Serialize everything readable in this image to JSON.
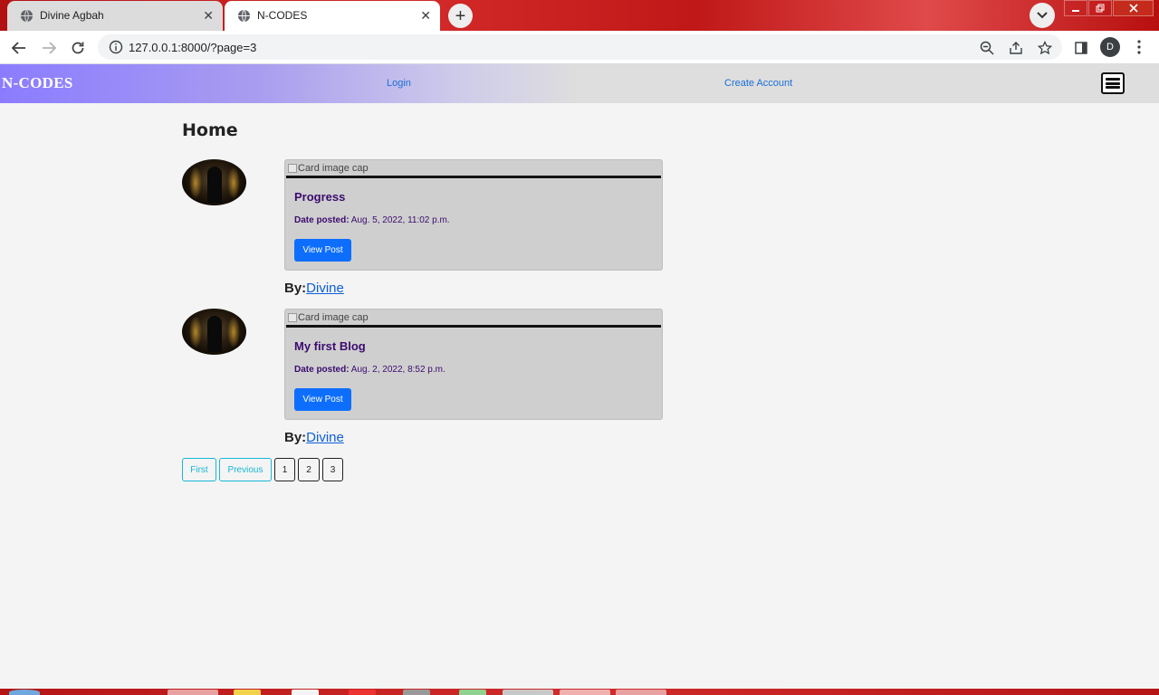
{
  "browser": {
    "tabs": [
      {
        "title": "Divine Agbah",
        "active": false
      },
      {
        "title": "N-CODES",
        "active": true
      }
    ],
    "new_tab_symbol": "+",
    "close_symbol": "✕",
    "url": "127.0.0.1:8000/?page=3",
    "profile_initial": "D",
    "icons": [
      "back-arrow-icon",
      "forward-arrow-icon",
      "reload-icon",
      "info-icon",
      "zoom-out-icon",
      "share-icon",
      "star-icon",
      "side-panel-icon",
      "kebab-menu-icon",
      "tab-search-icon"
    ]
  },
  "site": {
    "brand": "N-CODES",
    "nav": {
      "login": "Login",
      "create_account": "Create Account"
    },
    "colors": {
      "nav_gradient_start": "#8b7cff",
      "nav_bg": "#dedede",
      "link": "#1a6fd6",
      "card_title": "#3b0b6e",
      "primary_button": "#0d6efd",
      "pager_info": "#17b7d6"
    }
  },
  "main": {
    "title": "Home",
    "posts": [
      {
        "image_alt": "Card image cap",
        "title": "Progress",
        "date_label": "Date posted:",
        "date_value": "Aug. 5, 2022, 11:02 p.m.",
        "button": "View Post",
        "by_label": "By:",
        "author": "Divine"
      },
      {
        "image_alt": "Card image cap",
        "title": "My first Blog",
        "date_label": "Date posted:",
        "date_value": "Aug. 2, 2022, 8:52 p.m.",
        "button": "View Post",
        "by_label": "By:",
        "author": "Divine"
      }
    ],
    "pagination": {
      "first": "First",
      "previous": "Previous",
      "pages": [
        "1",
        "2",
        "3"
      ]
    }
  }
}
